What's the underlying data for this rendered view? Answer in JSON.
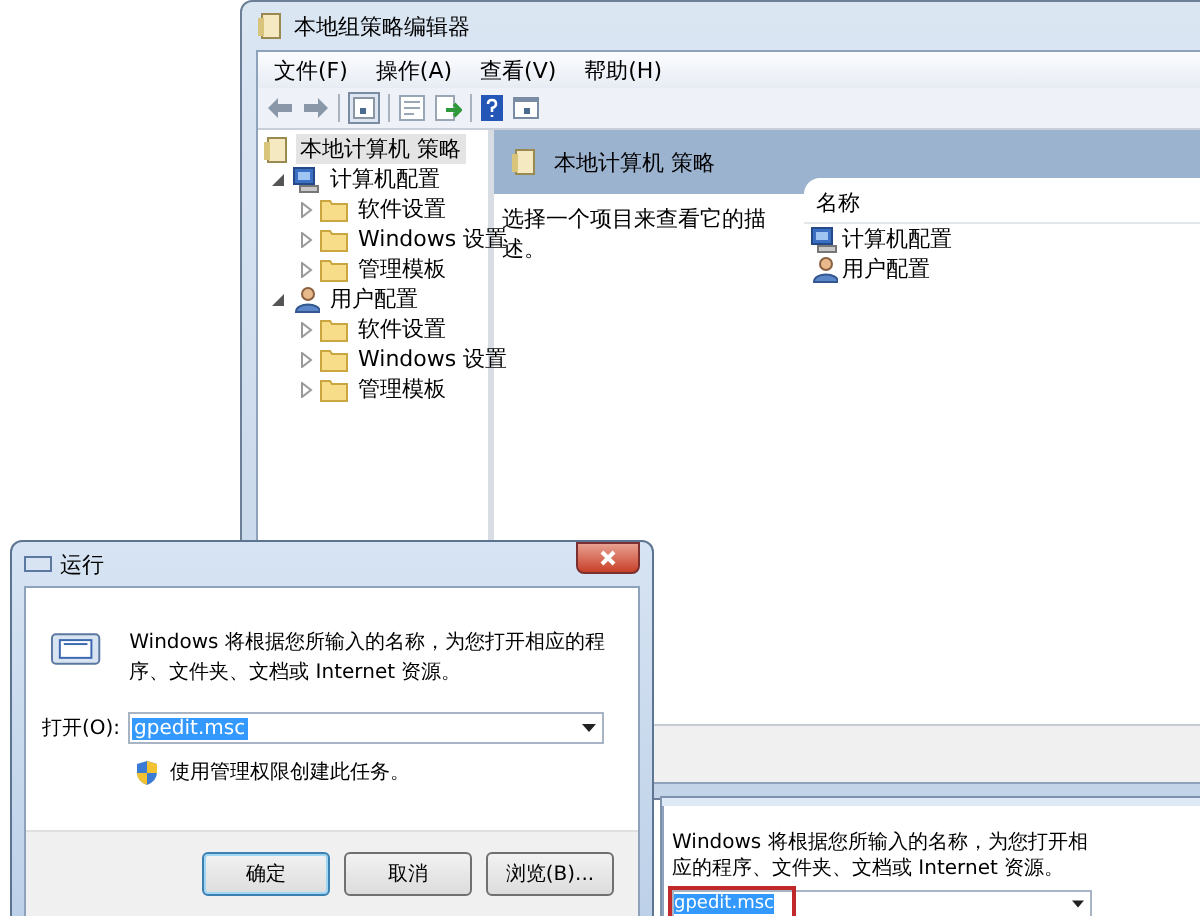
{
  "policy_editor": {
    "title": "本地组策略编辑器",
    "menu": [
      "文件(F)",
      "操作(A)",
      "查看(V)",
      "帮助(H)"
    ],
    "tree": [
      {
        "label": "本地计算机 策略",
        "kind": "policy",
        "selected": true,
        "children": [
          {
            "label": "计算机配置",
            "kind": "computer",
            "selected": false,
            "expanded": true,
            "children": [
              {
                "label": "软件设置",
                "kind": "folder",
                "selected": false,
                "expanded": false
              },
              {
                "label": "Windows 设置",
                "kind": "folder",
                "selected": false,
                "expanded": false
              },
              {
                "label": "管理模板",
                "kind": "folder",
                "selected": false,
                "expanded": false
              }
            ]
          },
          {
            "label": "用户配置",
            "kind": "user",
            "selected": false,
            "expanded": true,
            "children": [
              {
                "label": "软件设置",
                "kind": "folder",
                "selected": false,
                "expanded": false
              },
              {
                "label": "Windows 设置",
                "kind": "folder",
                "selected": false,
                "expanded": false
              },
              {
                "label": "管理模板",
                "kind": "folder",
                "selected": false,
                "expanded": false
              }
            ]
          }
        ]
      }
    ],
    "header": "本地计算机 策略",
    "description": "选择一个项目来查看它的描述。",
    "columns": [
      "名称"
    ],
    "items": [
      {
        "label": "计算机配置",
        "kind": "computer"
      },
      {
        "label": "用户配置",
        "kind": "user"
      }
    ]
  },
  "run_dialog": {
    "title": "运行",
    "message": "Windows 将根据您所输入的名称，为您打开相应的程序、文件夹、文档或 Internet 资源。",
    "open_label": "打开(O):",
    "value": "gpedit.msc",
    "value_selected": true,
    "admin_note": "使用管理权限创建此任务。",
    "buttons": [
      "确定",
      "取消",
      "浏览(B)..."
    ]
  },
  "run_dialog_partial": {
    "message": "Windows 将根据您所输入的名称，为您打开相应的程序、文件夹、文档或 Internet 资源。",
    "value": "gpedit.msc",
    "value_selected": true
  }
}
